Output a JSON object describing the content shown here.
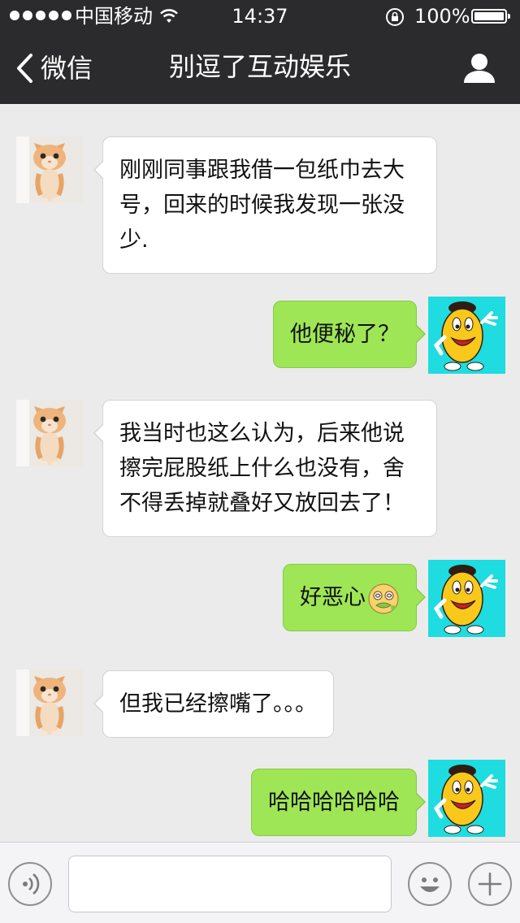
{
  "status_bar": {
    "carrier": "中国移动",
    "time": "14:37",
    "battery": "100%"
  },
  "nav": {
    "back_label": "微信",
    "title": "别逗了互动娱乐"
  },
  "messages": [
    {
      "side": "in",
      "text": "刚刚同事跟我借一包纸巾去大号，回来的时候我发现一张没少."
    },
    {
      "side": "out",
      "text": "他便秘了？"
    },
    {
      "side": "in",
      "text": "我当时也这么认为，后来他说擦完屁股纸上什么也没有，舍不得丢掉就叠好又放回去了！"
    },
    {
      "side": "out",
      "text": "好恶心",
      "emoji": "nauseated-emoji"
    },
    {
      "side": "in",
      "text": "但我已经擦嘴了。。。"
    },
    {
      "side": "out",
      "text": "哈哈哈哈哈哈"
    }
  ],
  "colors": {
    "nav_background": "#2b2b2d",
    "chat_background": "#ebebeb",
    "incoming_bubble": "#ffffff",
    "outgoing_bubble": "#9ee655"
  }
}
